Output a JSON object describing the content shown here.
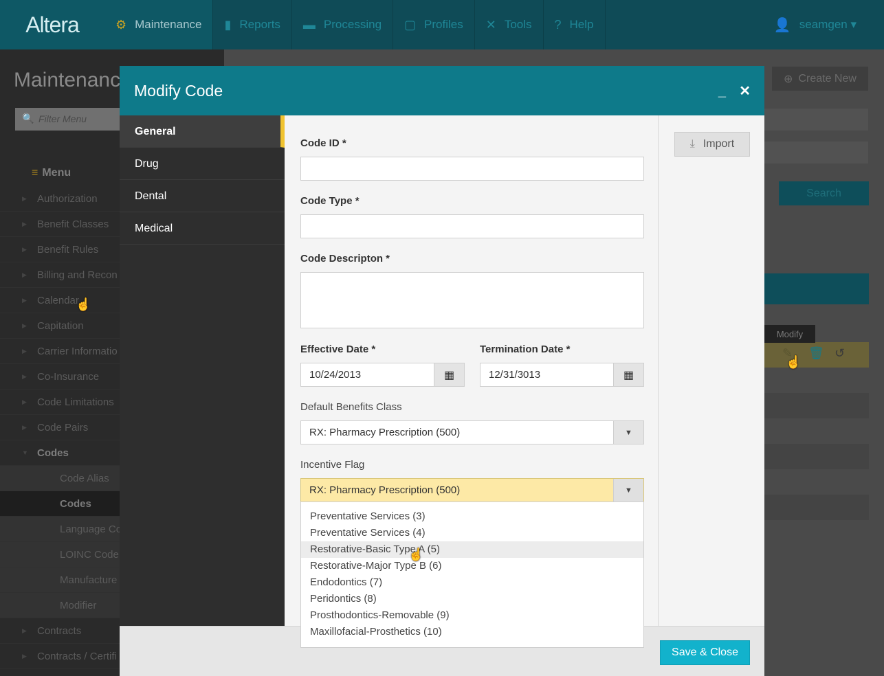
{
  "nav": {
    "logo": "Altera",
    "items": [
      {
        "label": "Maintenance",
        "icon": "gear-icon",
        "glyph": "⚙"
      },
      {
        "label": "Reports",
        "icon": "bar-chart-icon",
        "glyph": "▮"
      },
      {
        "label": "Processing",
        "icon": "folder-icon",
        "glyph": "▬"
      },
      {
        "label": "Profiles",
        "icon": "profile-icon",
        "glyph": "▢"
      },
      {
        "label": "Tools",
        "icon": "tools-icon",
        "glyph": "✕"
      },
      {
        "label": "Help",
        "icon": "help-icon",
        "glyph": "?"
      }
    ],
    "user": "seamgen ▾"
  },
  "background": {
    "page_title": "Maintenanc",
    "filter_placeholder": "Filter Menu",
    "menu_heading": "Menu",
    "menu_items": [
      "Authorization",
      "Benefit Classes",
      "Benefit Rules",
      "Billing and Recon",
      "Calendar",
      "Capitation",
      "Carrier Informatio",
      "Co-Insurance",
      "Code Limitations",
      "Code Pairs",
      "Codes",
      "Code Alias",
      "Codes",
      "Language Co",
      "LOINC Code",
      "Manufacture",
      "Modifier",
      "Contracts",
      "Contracts / Certifi"
    ],
    "create_new": "Create New",
    "search": "Search",
    "tooltip": "Modify"
  },
  "modal": {
    "title": "Modify Code",
    "minimize": "_",
    "close": "✕",
    "tabs": [
      "General",
      "Drug",
      "Dental",
      "Medical"
    ],
    "form": {
      "code_id_label": "Code ID *",
      "code_id_value": "",
      "code_type_label": "Code Type *",
      "code_type_value": "",
      "code_description_label": "Code Descripton *",
      "code_description_value": "",
      "effective_date_label": "Effective Date *",
      "effective_date_value": "10/24/2013",
      "termination_date_label": "Termination Date *",
      "termination_date_value": "12/31/3013",
      "default_benefits_label": "Default Benefits Class",
      "default_benefits_value": "RX: Pharmacy Prescription (500)",
      "incentive_flag_label": "Incentive Flag",
      "incentive_flag_value": "RX: Pharmacy Prescription (500)",
      "incentive_options": [
        "Preventative Services (3)",
        "Preventative Services (4)",
        "Restorative-Basic Type A (5)",
        "Restorative-Major Type B (6)",
        "Endodontics (7)",
        "Peridontics (8)",
        "Prosthodontics-Removable (9)",
        "Maxillofacial-Prosthetics (10)"
      ]
    },
    "import_label": "Import",
    "save_close_label": "Save & Close"
  },
  "colors": {
    "header": "#0e7a8a",
    "accent_tab": "#f0c330",
    "save": "#12b2cc",
    "select_focus": "#fde9a6"
  }
}
